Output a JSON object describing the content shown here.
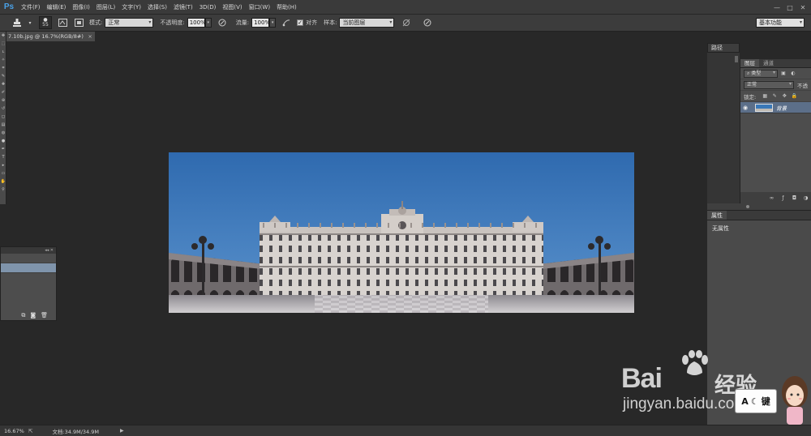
{
  "app": {
    "logo": "Ps"
  },
  "menu": [
    "文件(F)",
    "编辑(E)",
    "图像(I)",
    "图层(L)",
    "文字(Y)",
    "选择(S)",
    "滤镜(T)",
    "3D(D)",
    "视图(V)",
    "窗口(W)",
    "帮助(H)"
  ],
  "window_controls": [
    "—",
    "□",
    "✕"
  ],
  "options": {
    "brush_size": "55",
    "mode_label": "模式:",
    "mode_value": "正常",
    "opacity_label": "不透明度:",
    "opacity_value": "100%",
    "flow_label": "流量:",
    "flow_value": "100%",
    "align_label": "对齐",
    "align_checked": "✓",
    "sample_label": "样本:",
    "sample_value": "当前图层",
    "workspace": "基本功能"
  },
  "document": {
    "tab_title": "7.10b.jpg @ 16.7%(RGB/8#)",
    "close": "×"
  },
  "right_panels": {
    "paths_tab": "路径",
    "layers_tab": "图层",
    "channels_tab": "通道",
    "filter_kind": "类型",
    "blend_mode": "正常",
    "opacity_short": "不透",
    "lock_label": "锁定:",
    "layer_name": "背景",
    "properties_tab": "属性",
    "properties_text": "无属性"
  },
  "status": {
    "zoom": "16.67%",
    "doc_info": "文档:34.9M/34.9M"
  },
  "watermark": {
    "bai": "Bai",
    "du": "经验",
    "url": "jingyan.baidu.com",
    "box_text_a": "A",
    "box_text_b": "键"
  },
  "colors": {
    "sky": "#3c78bb",
    "canvas_bg": "#282828",
    "layer_selected": "#5c6f89",
    "ps_blue": "#4aa2e8"
  },
  "icons": {
    "toolbox": [
      "move-icon",
      "marquee-icon",
      "lasso-icon",
      "quick-select-icon",
      "crop-icon",
      "eyedropper-icon",
      "healing-icon",
      "brush-icon",
      "clone-stamp-icon",
      "history-brush-icon",
      "eraser-icon",
      "gradient-icon",
      "blur-icon",
      "dodge-icon",
      "pen-icon",
      "type-icon",
      "path-select-icon",
      "shape-icon",
      "hand-icon",
      "zoom-icon"
    ]
  }
}
